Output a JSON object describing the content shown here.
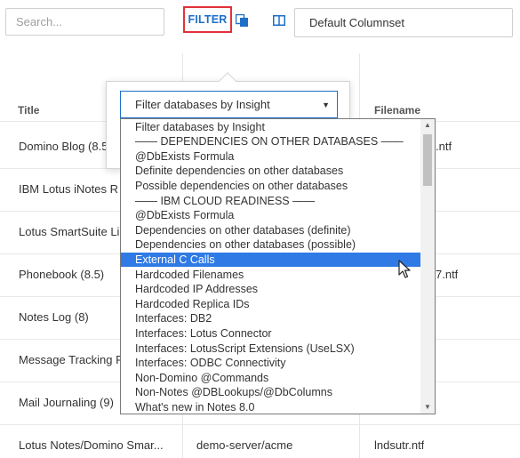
{
  "toolbar": {
    "search_placeholder": "Search...",
    "filter_label": "FILTER",
    "columnset_value": "Default Columnset"
  },
  "table": {
    "headers": {
      "title": "Title",
      "filename": "Filename"
    },
    "rows": [
      {
        "title": "Domino Blog (8.5",
        "server": "",
        "filename": ".ntf"
      },
      {
        "title": "IBM Lotus iNotes R",
        "server": "",
        "filename": ""
      },
      {
        "title": "Lotus SmartSuite Li",
        "server": "",
        "filename": ""
      },
      {
        "title": "Phonebook (8.5)",
        "server": "",
        "filename": "7.ntf"
      },
      {
        "title": "Notes Log (8)",
        "server": "",
        "filename": ""
      },
      {
        "title": "Message Tracking R",
        "server": "",
        "filename": ""
      },
      {
        "title": "Mail Journaling (9)",
        "server": "",
        "filename": ""
      },
      {
        "title": "Lotus Notes/Domino Smar...",
        "server": "demo-server/acme",
        "filename": "lndsutr.ntf"
      }
    ]
  },
  "filter_popover": {
    "insight_select_value": "Filter databases by Insight",
    "options": [
      "Filter databases by Insight",
      "—— DEPENDENCIES ON OTHER DATABASES ——",
      "@DbExists Formula",
      "Definite dependencies on other databases",
      "Possible dependencies on other databases",
      "—— IBM CLOUD READINESS ——",
      "@DbExists Formula",
      "Dependencies on other databases (definite)",
      "Dependencies on other databases (possible)",
      "External C Calls",
      "Hardcoded Filenames",
      "Hardcoded IP Addresses",
      "Hardcoded Replica IDs",
      "Interfaces: DB2",
      "Interfaces: Lotus Connector",
      "Interfaces: LotusScript Extensions (UseLSX)",
      "Interfaces: ODBC Connectivity",
      "Non-Domino @Commands",
      "Non-Notes @DBLookups/@DbColumns",
      "What's new in Notes 8.0"
    ],
    "highlighted_option": "External C Calls"
  },
  "colors": {
    "accent": "#1e6fc8",
    "filter_outline": "#e2323a",
    "selection": "#2f7ae5"
  },
  "icons": [
    "copy-icon",
    "columns-icon",
    "caret-down-icon",
    "scroll-up-icon",
    "scroll-down-icon",
    "mouse-pointer-icon"
  ]
}
